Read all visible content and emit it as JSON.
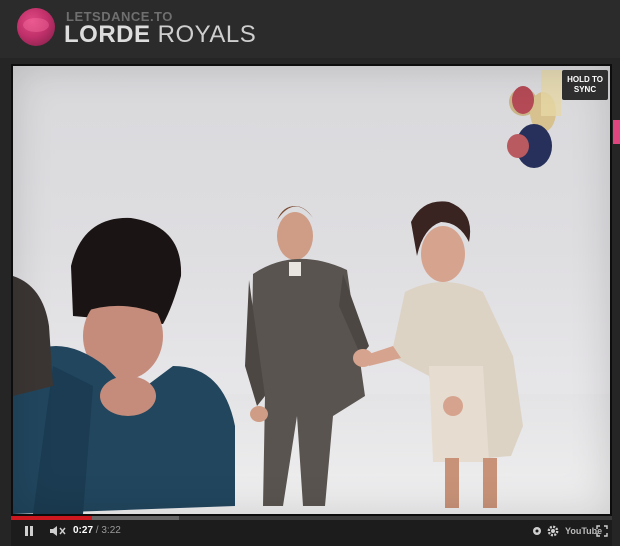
{
  "header": {
    "site_name": "LETSDANCE.TO",
    "artist": "LORDE",
    "song": "ROYALS"
  },
  "video": {
    "hold_to_sync_label": "HOLD TO SYNC",
    "current_time": "0:27",
    "separator": "/",
    "total_time": "3:22",
    "progress_fraction": 0.134,
    "buffered_fraction": 0.28,
    "youtube_label": "YouTube"
  },
  "icons": {
    "pause": "pause-icon",
    "volume": "volume-muted-icon",
    "captions": "captions-icon",
    "settings": "gear-icon",
    "fullscreen": "fullscreen-icon"
  },
  "colors": {
    "accent": "#e0457f",
    "progress": "#cc181e",
    "header_bg": "#2b2b2b",
    "controls_bg": "#1c1c1c"
  }
}
